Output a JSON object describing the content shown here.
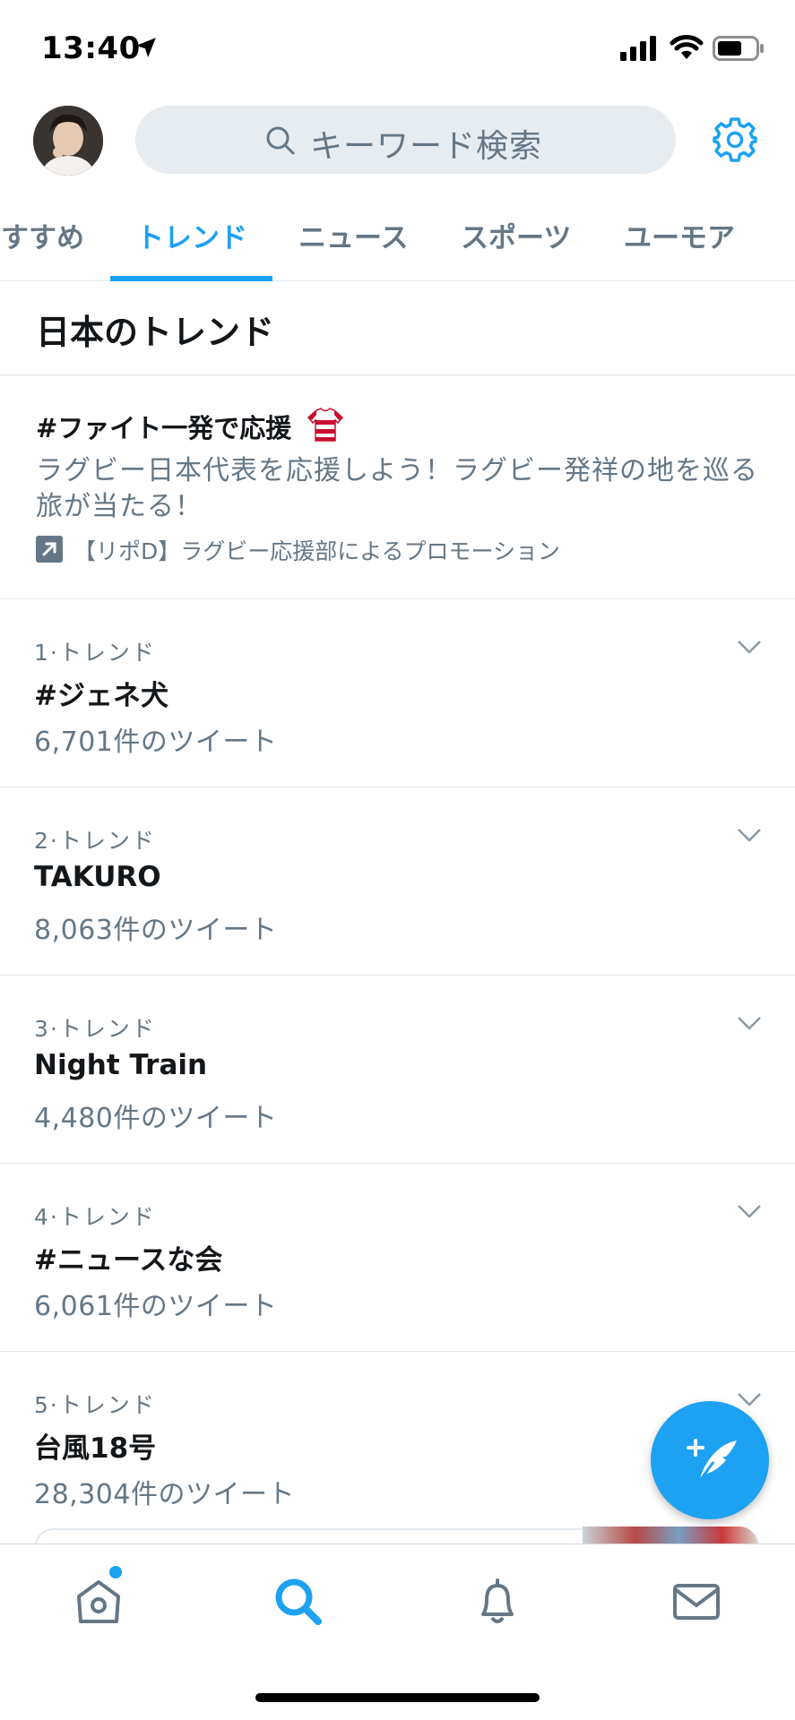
{
  "status_bar": {
    "time": "13:40"
  },
  "search": {
    "placeholder": "キーワード検索"
  },
  "tabs": [
    {
      "label": "おすすめ"
    },
    {
      "label": "トレンド"
    },
    {
      "label": "ニュース"
    },
    {
      "label": "スポーツ"
    },
    {
      "label": "ユーモア"
    }
  ],
  "active_tab": "トレンド",
  "section_title": "日本のトレンド",
  "promoted": {
    "title": "#ファイト一発で応援",
    "description": "ラグビー日本代表を応援しよう！ラグビー発祥の地を巡る旅が当たる！",
    "promoter": "【リポD】ラグビー応援部によるプロモーション"
  },
  "trends": [
    {
      "meta": "1·トレンド",
      "name": "#ジェネ犬",
      "count": "6,701件のツイート"
    },
    {
      "meta": "2·トレンド",
      "name": "TAKURO",
      "count": "8,063件のツイート"
    },
    {
      "meta": "3·トレンド",
      "name": "Night Train",
      "count": "4,480件のツイート"
    },
    {
      "meta": "4·トレンド",
      "name": "#ニュースな会",
      "count": "6,061件のツイート"
    },
    {
      "meta": "5·トレンド",
      "name": "台風18号",
      "count": "28,304件のツイート"
    }
  ],
  "icons": {
    "settings": "gear-icon",
    "compose": "compose-tweet-icon",
    "home": "home-icon",
    "search": "search-icon",
    "notifications": "bell-icon",
    "messages": "mail-icon"
  },
  "colors": {
    "accent": "#1da1f2",
    "text": "#14171a",
    "secondary": "#657786",
    "divider": "#e1e8ed"
  }
}
